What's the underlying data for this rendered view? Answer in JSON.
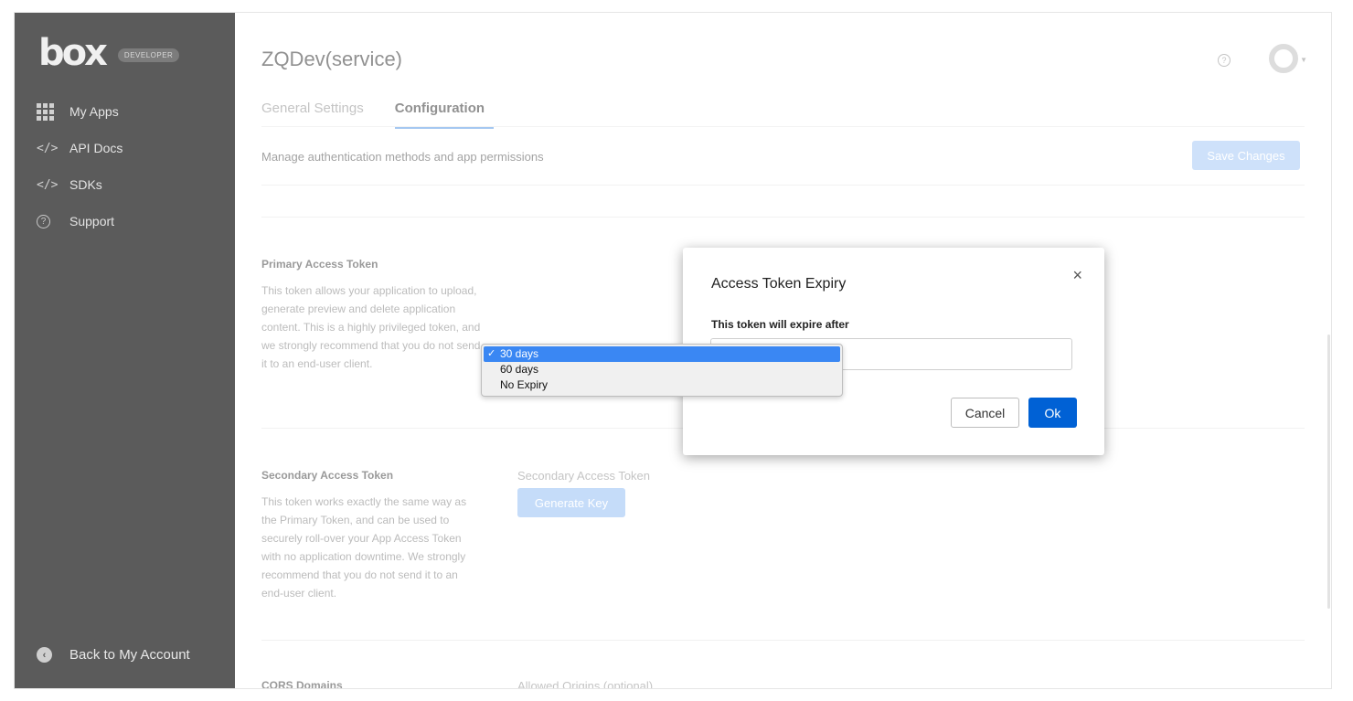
{
  "sidebar": {
    "logo": "box",
    "badge": "DEVELOPER",
    "items": [
      {
        "label": "My Apps"
      },
      {
        "label": "API Docs",
        "icon": "</>"
      },
      {
        "label": "SDKs",
        "icon": "</>"
      },
      {
        "label": "Support",
        "icon": "?"
      }
    ],
    "back_label": "Back to My Account"
  },
  "header": {
    "title": "ZQDev(service)",
    "help_icon": "?"
  },
  "tabs": [
    {
      "label": "General Settings"
    },
    {
      "label": "Configuration"
    }
  ],
  "main": {
    "subtitle": "Manage authentication methods and app permissions",
    "save_label": "Save Changes",
    "primary": {
      "title": "Primary Access Token",
      "desc": "This token allows your application to upload, generate preview and delete application content. This is a highly privileged token, and we strongly recommend that you do not send it to an end-user client."
    },
    "secondary": {
      "title": "Secondary Access Token",
      "desc": "This token works exactly the same way as the Primary Token, and can be used to securely roll-over your App Access Token with no application downtime. We strongly recommend that you do not send it to an end-user client.",
      "field_label": "Secondary Access Token",
      "button": "Generate Key"
    },
    "cors": {
      "title": "CORS Domains",
      "field_label": "Allowed Origins (optional)"
    }
  },
  "modal": {
    "title": "Access Token Expiry",
    "close": "×",
    "label": "This token will expire after",
    "options": [
      "30 days",
      "60 days",
      "No Expiry"
    ],
    "selected": "30 days",
    "check": "✓",
    "cancel": "Cancel",
    "ok": "Ok"
  },
  "colors": {
    "sidebar_bg": "#5b5b5b",
    "accent": "#0061d5",
    "selected_option": "#3a87f3"
  }
}
